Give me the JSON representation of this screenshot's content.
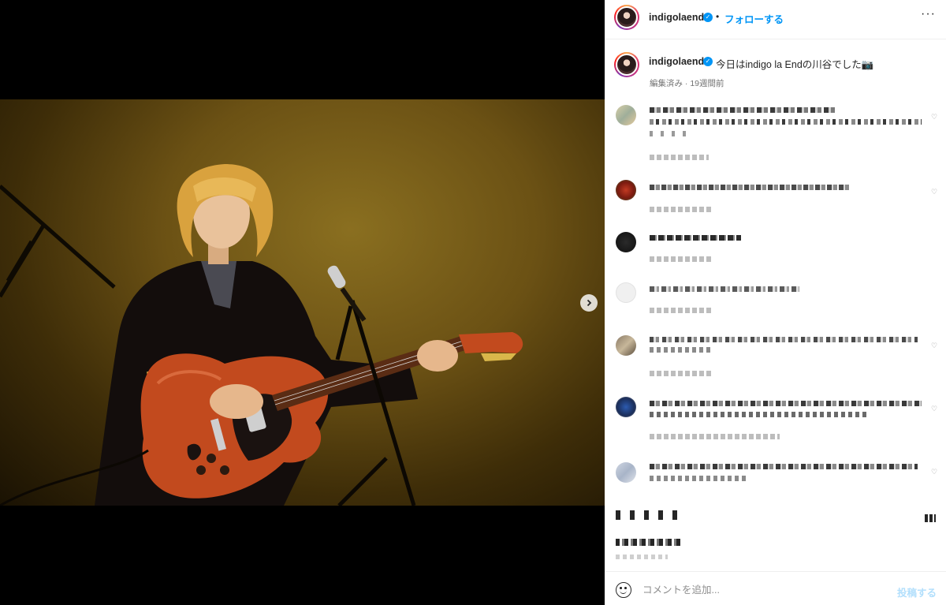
{
  "post": {
    "username": "indigolaend",
    "verified_mark": "✓",
    "separator": "•",
    "follow_label": "フォローする",
    "more_icon": "more-horizontal-icon"
  },
  "caption": {
    "username": "indigolaend",
    "text": "今日はindigo la Endの川谷でした📷",
    "meta": "編集済み · 19週間前"
  },
  "carousel": {
    "next_icon": "chevron-right-icon",
    "slide_count": 2,
    "active_slide": 1
  },
  "composer": {
    "emoji_icon": "emoji-smile-icon",
    "placeholder": "コメントを追加...",
    "post_label": "投稿する"
  },
  "colors": {
    "accent": "#0095f6",
    "post_disabled": "#b2dffc",
    "stage_light": "#8a6f20"
  }
}
